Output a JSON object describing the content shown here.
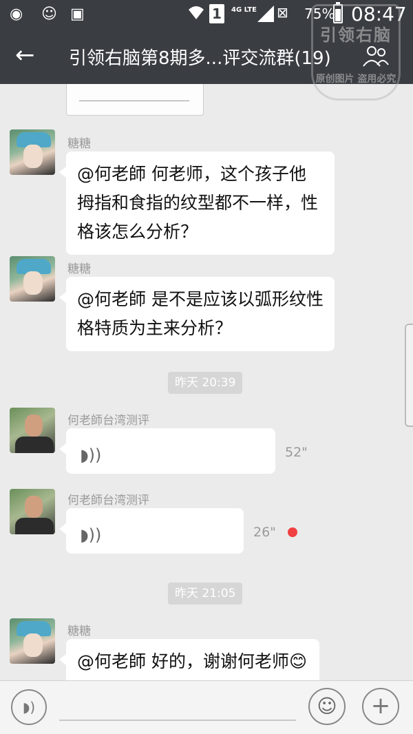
{
  "status_bar": {
    "network": "4G LTE",
    "sim_slot": "1",
    "battery": "75%",
    "battery_level": 0.75,
    "time": "08:47",
    "icons": [
      "weibo-icon",
      "sunglasses-icon",
      "clipboard-icon",
      "wifi-icon",
      "signal-icon",
      "no-sim-icon",
      "battery-icon"
    ]
  },
  "header": {
    "title": "引领右脑第8期多...评交流群(19)",
    "back_icon": "←",
    "group_icon": "group-members-icon"
  },
  "watermark": {
    "main": "引领右脑",
    "sub": "原创图片 盗用必究"
  },
  "messages": [
    {
      "type": "text",
      "sender": "糖糖",
      "avatar": "girl",
      "text_lines": [
        "@何老師 何老师，这个孩子他",
        "拇指和食指的纹型都不一样，性",
        "格该怎么分析？"
      ]
    },
    {
      "type": "text",
      "sender": "糖糖",
      "avatar": "girl",
      "text_lines": [
        "@何老師 是不是应该以弧形纹性",
        "格特质为主来分析？"
      ]
    },
    {
      "type": "time",
      "text": "昨天 20:39"
    },
    {
      "type": "voice",
      "sender": "何老師台湾测评",
      "avatar": "man",
      "duration": "52\"",
      "unread": false
    },
    {
      "type": "voice",
      "sender": "何老師台湾测评",
      "avatar": "man",
      "duration": "26\"",
      "unread": true
    },
    {
      "type": "time",
      "text": "昨天 21:05"
    },
    {
      "type": "text",
      "sender": "糖糖",
      "avatar": "girl",
      "text_lines": [
        "@何老師 好的，谢谢何老师😊"
      ]
    }
  ],
  "input_bar": {
    "voice_icon": "voice-mode-icon",
    "emoji_icon": "emoji-icon",
    "plus_icon": "plus-icon"
  },
  "colors": {
    "header_bg": "#3a3d42",
    "chat_bg": "#ebebeb",
    "unread_dot": "#f04040"
  }
}
